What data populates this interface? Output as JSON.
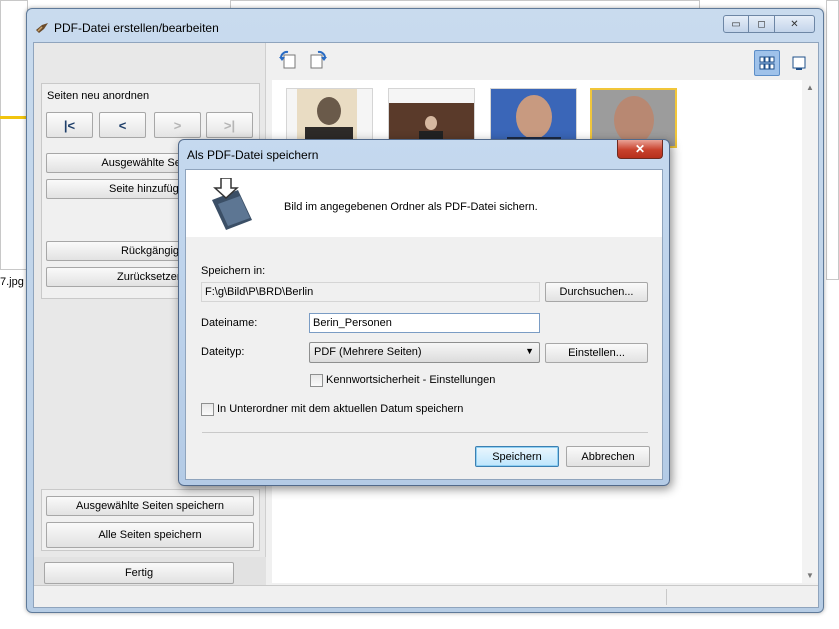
{
  "background": {
    "file_label": "7.jpg"
  },
  "window": {
    "title": "PDF-Datei erstellen/bearbeiten",
    "controls": {
      "minimize": "▭",
      "maximize": "◻",
      "close": "✕"
    }
  },
  "left_panel": {
    "group_label": "Seiten neu anordnen",
    "nav": {
      "first": "|<",
      "prev": "<",
      "next": ">",
      "last": ">|"
    },
    "buttons": {
      "delete_selected": "Ausgewählte Seiten",
      "add_page": "Seite hinzufügen",
      "undo": "Rückgängig",
      "reset": "Zurücksetzen",
      "save_selected": "Ausgewählte Seiten speichern",
      "save_all": "Alle Seiten speichern",
      "done": "Fertig"
    }
  },
  "toolbar": {
    "rotate_left_icon": "rotate-left-icon",
    "rotate_right_icon": "rotate-right-icon",
    "thumbnail_view_icon": "grid-view-icon",
    "page_view_icon": "single-page-view-icon"
  },
  "thumbnails": [
    {
      "name": "photo-1",
      "selected": false
    },
    {
      "name": "photo-2",
      "selected": false
    },
    {
      "name": "photo-3",
      "selected": false
    },
    {
      "name": "photo-4",
      "selected": true
    }
  ],
  "dialog": {
    "title": "Als PDF-Datei speichern",
    "close": "✕",
    "description": "Bild im angegebenen Ordner als PDF-Datei sichern.",
    "save_in_label": "Speichern in:",
    "save_in_value": "F:\\g\\Bild\\P\\BRD\\Berlin",
    "browse_button": "Durchsuchen...",
    "filename_label": "Dateiname:",
    "filename_value": "Berin_Personen",
    "filetype_label": "Dateityp:",
    "filetype_value": "PDF (Mehrere Seiten)",
    "settings_button": "Einstellen...",
    "password_checkbox": {
      "label": "Kennwortsicherheit - Einstellungen",
      "checked": false
    },
    "subfolder_checkbox": {
      "label": "In Unterordner mit dem aktuellen Datum speichern",
      "checked": false
    },
    "save_button": "Speichern",
    "cancel_button": "Abbrechen"
  },
  "colors": {
    "window_frame": "#b7cde5",
    "selection": "#f1c63a",
    "close_red": "#c8412c"
  }
}
